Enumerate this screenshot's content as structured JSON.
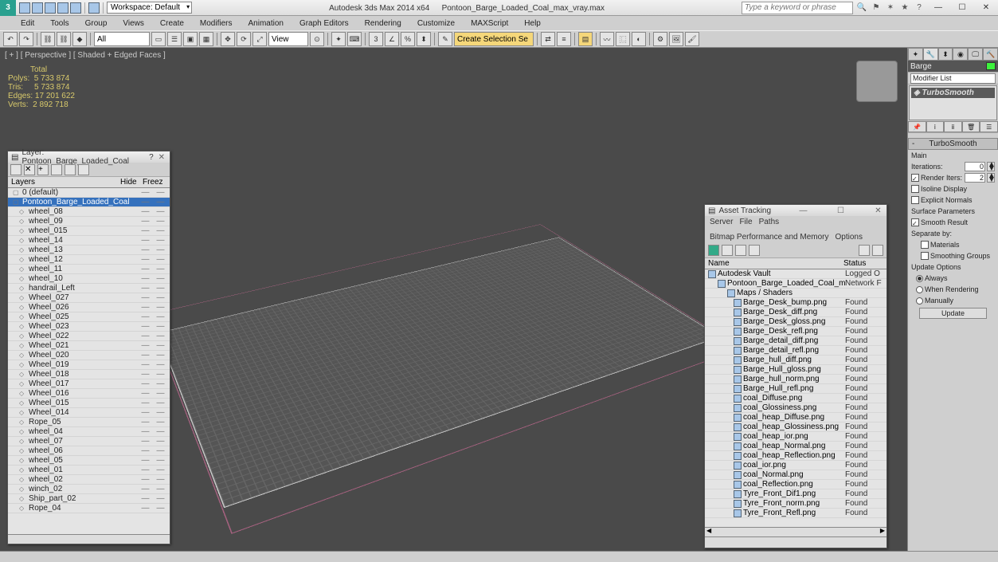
{
  "app": {
    "title_left": "Autodesk 3ds Max  2014 x64",
    "title_right": "Pontoon_Barge_Loaded_Coal_max_vray.max",
    "workspace": "Workspace: Default",
    "search_placeholder": "Type a keyword or phrase"
  },
  "menu": [
    "Edit",
    "Tools",
    "Group",
    "Views",
    "Create",
    "Modifiers",
    "Animation",
    "Graph Editors",
    "Rendering",
    "Customize",
    "MAXScript",
    "Help"
  ],
  "toolbar": {
    "selection_filter": "All",
    "named_sel": "Create Selection Se"
  },
  "viewport": {
    "label": "[ + ] [ Perspective ] [ Shaded + Edged Faces ]",
    "stats": {
      "head": "Total",
      "polys_l": "Polys:",
      "polys_v": "5 733 874",
      "tris_l": "Tris:",
      "tris_v": "5 733 874",
      "edges_l": "Edges:",
      "edges_v": "17 201 622",
      "verts_l": "Verts:",
      "verts_v": "2 892 718"
    }
  },
  "layer_panel": {
    "title": "Layer: Pontoon_Barge_Loaded_Coal",
    "cols": {
      "a": "Layers",
      "b": "Hide",
      "c": "Freez"
    },
    "items": [
      {
        "n": "0 (default)",
        "root": true
      },
      {
        "n": "Pontoon_Barge_Loaded_Coal",
        "root": true,
        "sel": true
      },
      {
        "n": "wheel_08"
      },
      {
        "n": "wheel_09"
      },
      {
        "n": "wheel_015"
      },
      {
        "n": "wheel_14"
      },
      {
        "n": "wheel_13"
      },
      {
        "n": "wheel_12"
      },
      {
        "n": "wheel_11"
      },
      {
        "n": "wheel_10"
      },
      {
        "n": "handrail_Left"
      },
      {
        "n": "Wheel_027"
      },
      {
        "n": "Wheel_026"
      },
      {
        "n": "Wheel_025"
      },
      {
        "n": "Wheel_023"
      },
      {
        "n": "Wheel_022"
      },
      {
        "n": "Wheel_021"
      },
      {
        "n": "Wheel_020"
      },
      {
        "n": "Wheel_019"
      },
      {
        "n": "Wheel_018"
      },
      {
        "n": "Wheel_017"
      },
      {
        "n": "Wheel_016"
      },
      {
        "n": "Wheel_015"
      },
      {
        "n": "Wheel_014"
      },
      {
        "n": "Rope_05"
      },
      {
        "n": "wheel_04"
      },
      {
        "n": "wheel_07"
      },
      {
        "n": "wheel_06"
      },
      {
        "n": "wheel_05"
      },
      {
        "n": "wheel_01"
      },
      {
        "n": "wheel_02"
      },
      {
        "n": "winch_02"
      },
      {
        "n": "Ship_part_02"
      },
      {
        "n": "Rope_04"
      }
    ]
  },
  "asset_panel": {
    "title": "Asset Tracking",
    "menu": [
      "Server",
      "File",
      "Paths",
      "Bitmap Performance and Memory",
      "Options"
    ],
    "cols": {
      "a": "Name",
      "b": "Status"
    },
    "rows": [
      {
        "l": 0,
        "n": "Autodesk Vault",
        "s": "Logged O"
      },
      {
        "l": 1,
        "n": "Pontoon_Barge_Loaded_Coal_max_vray.max",
        "s": "Network F"
      },
      {
        "l": 2,
        "n": "Maps / Shaders",
        "s": ""
      },
      {
        "l": 3,
        "n": "Barge_Desk_bump.png",
        "s": "Found"
      },
      {
        "l": 3,
        "n": "Barge_Desk_diff.png",
        "s": "Found"
      },
      {
        "l": 3,
        "n": "Barge_Desk_gloss.png",
        "s": "Found"
      },
      {
        "l": 3,
        "n": "Barge_Desk_refl.png",
        "s": "Found"
      },
      {
        "l": 3,
        "n": "Barge_detail_diff.png",
        "s": "Found"
      },
      {
        "l": 3,
        "n": "Barge_detail_refl.png",
        "s": "Found"
      },
      {
        "l": 3,
        "n": "Barge_hull_diff.png",
        "s": "Found"
      },
      {
        "l": 3,
        "n": "Barge_Hull_gloss.png",
        "s": "Found"
      },
      {
        "l": 3,
        "n": "Barge_hull_norm.png",
        "s": "Found"
      },
      {
        "l": 3,
        "n": "Barge_Hull_refl.png",
        "s": "Found"
      },
      {
        "l": 3,
        "n": "coal_Diffuse.png",
        "s": "Found"
      },
      {
        "l": 3,
        "n": "coal_Glossiness.png",
        "s": "Found"
      },
      {
        "l": 3,
        "n": "coal_heap_Diffuse.png",
        "s": "Found"
      },
      {
        "l": 3,
        "n": "coal_heap_Glossiness.png",
        "s": "Found"
      },
      {
        "l": 3,
        "n": "coal_heap_ior.png",
        "s": "Found"
      },
      {
        "l": 3,
        "n": "coal_heap_Normal.png",
        "s": "Found"
      },
      {
        "l": 3,
        "n": "coal_heap_Reflection.png",
        "s": "Found"
      },
      {
        "l": 3,
        "n": "coal_ior.png",
        "s": "Found"
      },
      {
        "l": 3,
        "n": "coal_Normal.png",
        "s": "Found"
      },
      {
        "l": 3,
        "n": "coal_Reflection.png",
        "s": "Found"
      },
      {
        "l": 3,
        "n": "Tyre_Front_Dif1.png",
        "s": "Found"
      },
      {
        "l": 3,
        "n": "Tyre_Front_norm.png",
        "s": "Found"
      },
      {
        "l": 3,
        "n": "Tyre_Front_Refl.png",
        "s": "Found"
      }
    ]
  },
  "cmd": {
    "obj_name": "Barge",
    "mod_list_label": "Modifier List",
    "modifier": "TurboSmooth",
    "roll1": "TurboSmooth",
    "main_label": "Main",
    "iter_label": "Iterations:",
    "iter_val": "0",
    "rend_label": "Render Iters:",
    "rend_val": "2",
    "isoline": "Isoline Display",
    "explicit": "Explicit Normals",
    "surf_head": "Surface Parameters",
    "smooth_res": "Smooth Result",
    "separate": "Separate by:",
    "materials": "Materials",
    "sm_groups": "Smoothing Groups",
    "upd_head": "Update Options",
    "always": "Always",
    "when_rend": "When Rendering",
    "manually": "Manually",
    "update_btn": "Update"
  }
}
